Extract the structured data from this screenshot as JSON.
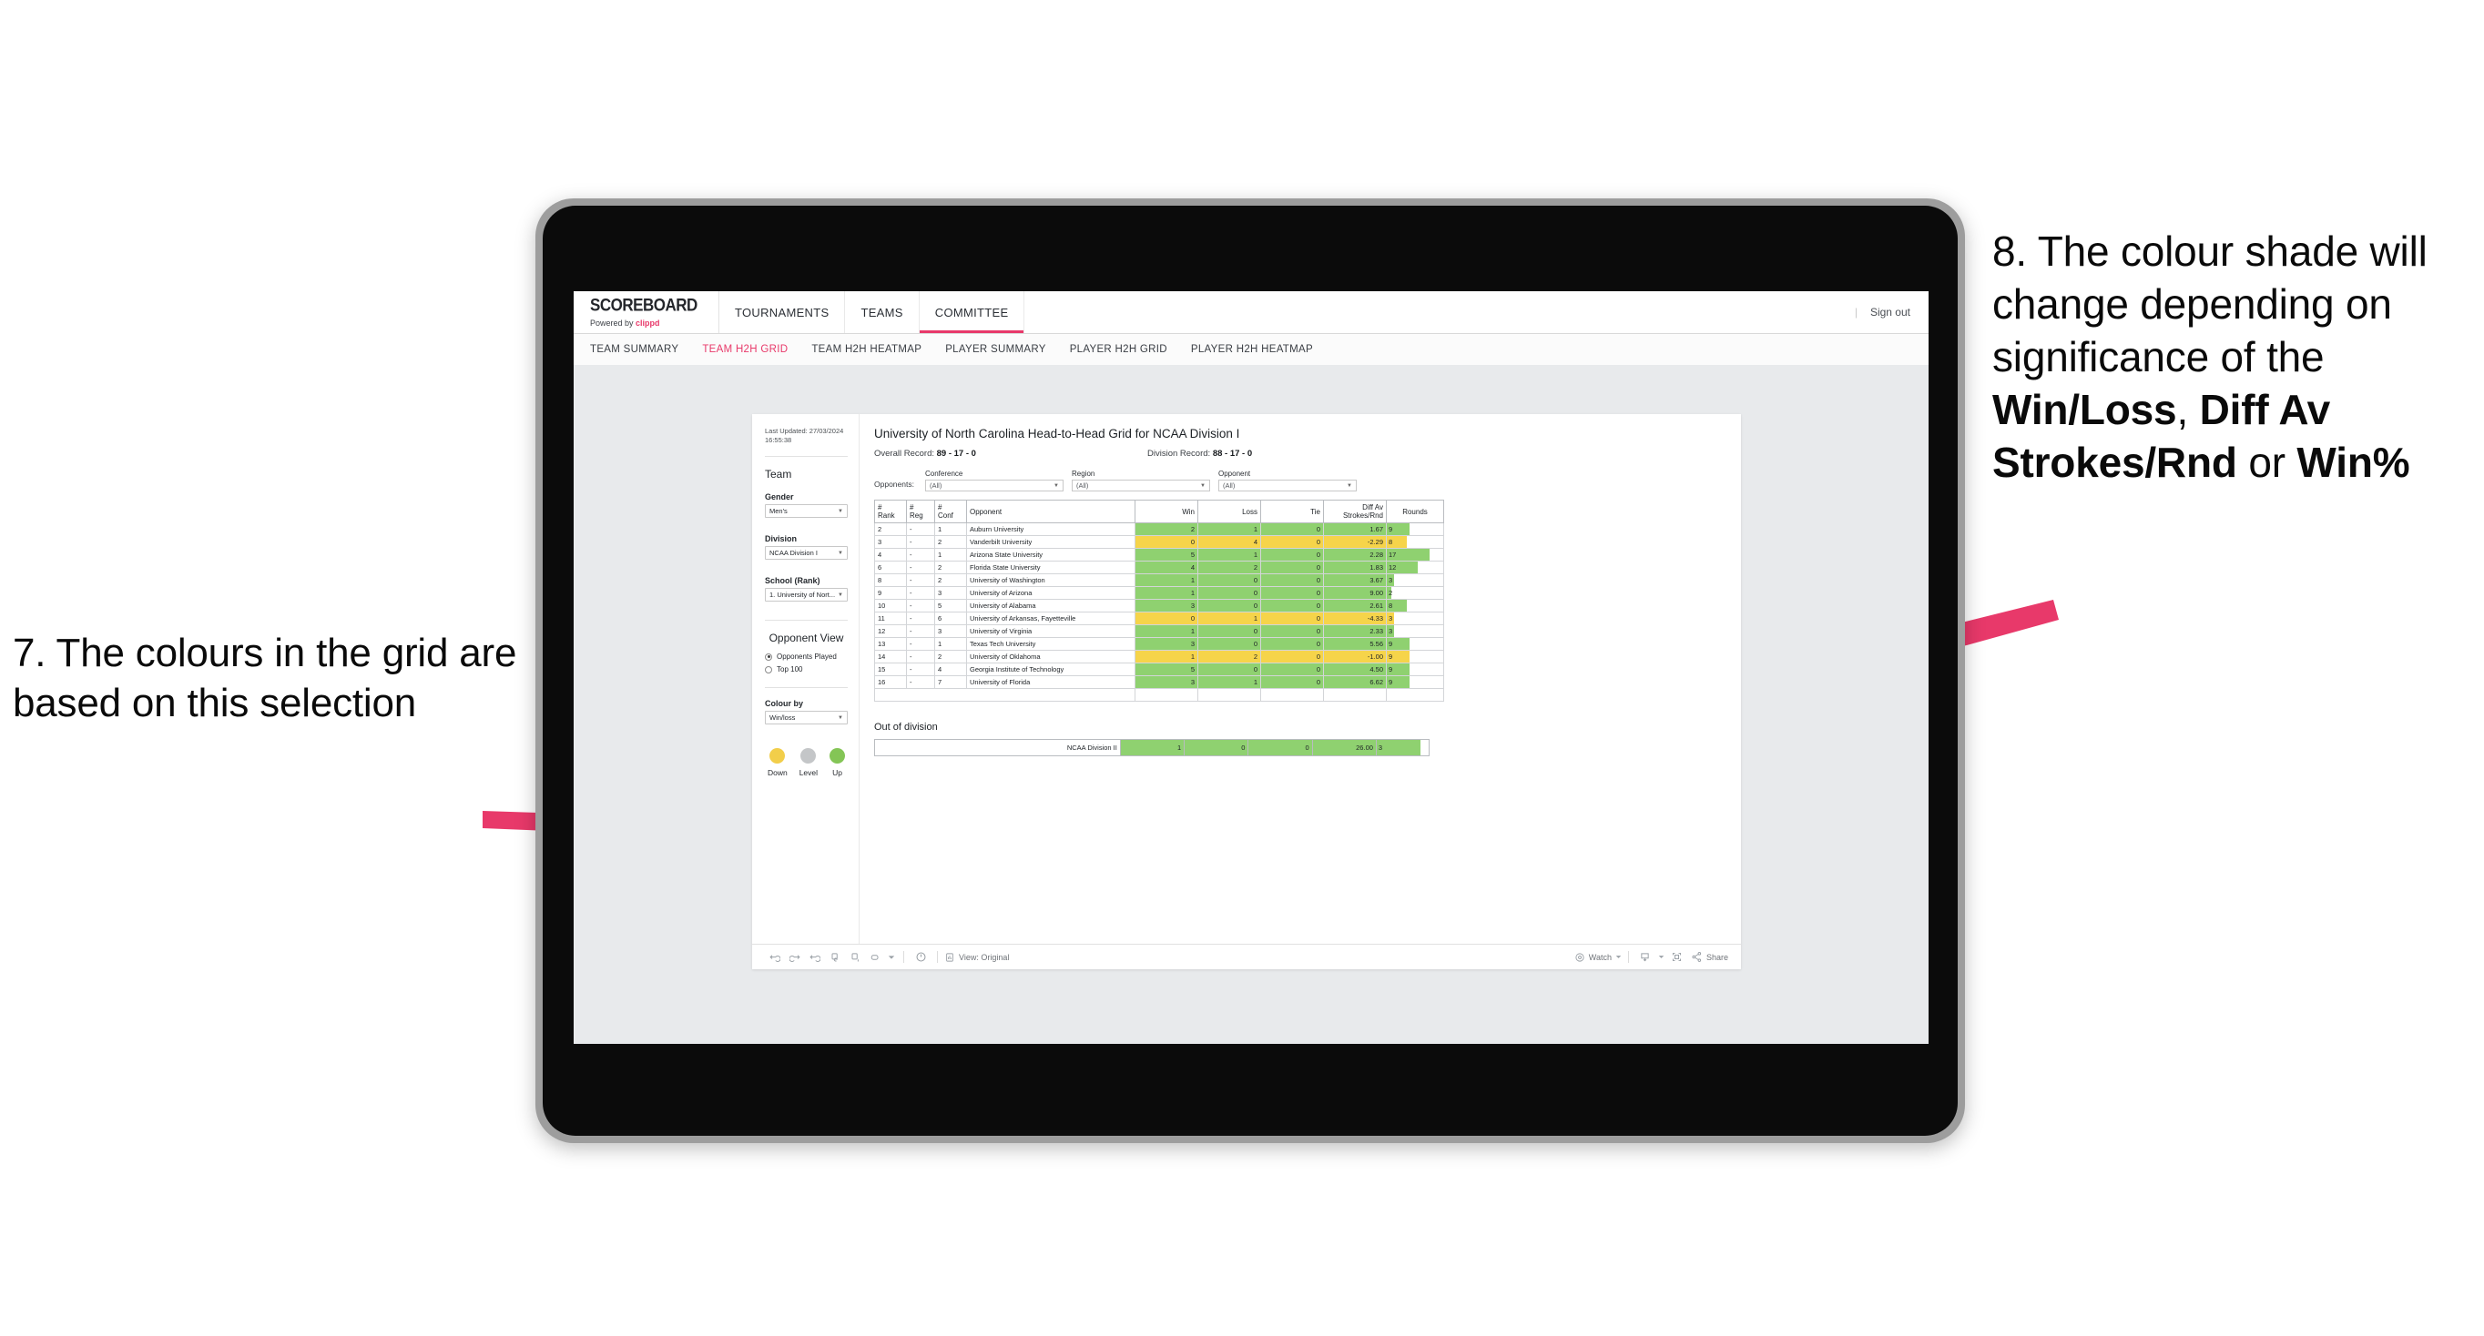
{
  "annotations": {
    "left": {
      "text": "7. The colours in the grid are based on this selection"
    },
    "right": {
      "line1": "8. The colour shade will change depending on significance of the ",
      "bold1": "Win/Loss",
      "mid1": ", ",
      "bold2": "Diff Av Strokes/Rnd",
      "mid2": " or ",
      "bold3": "Win%"
    },
    "arrow_color": "#e8396a"
  },
  "app": {
    "brand": {
      "title": "SCOREBOARD",
      "powered_by": "Powered by ",
      "clippd": "clippd"
    },
    "topnav": [
      {
        "label": "TOURNAMENTS",
        "active": false
      },
      {
        "label": "TEAMS",
        "active": false
      },
      {
        "label": "COMMITTEE",
        "active": true
      }
    ],
    "signout_divider": "|",
    "signout": "Sign out",
    "subnav": [
      {
        "label": "TEAM SUMMARY",
        "active": false
      },
      {
        "label": "TEAM H2H GRID",
        "active": true
      },
      {
        "label": "TEAM H2H HEATMAP",
        "active": false
      },
      {
        "label": "PLAYER SUMMARY",
        "active": false
      },
      {
        "label": "PLAYER H2H GRID",
        "active": false
      },
      {
        "label": "PLAYER H2H HEATMAP",
        "active": false
      }
    ],
    "accent": "#e8396a"
  },
  "filters": {
    "last_updated": "Last Updated: 27/03/2024 16:55:38",
    "team_heading": "Team",
    "gender_label": "Gender",
    "gender_value": "Men's",
    "division_label": "Division",
    "division_value": "NCAA Division I",
    "school_label": "School (Rank)",
    "school_value": "1. University of Nort...",
    "opponent_view_heading": "Opponent View",
    "opponent_view_options": [
      {
        "label": "Opponents Played",
        "selected": true
      },
      {
        "label": "Top 100",
        "selected": false
      }
    ],
    "colour_by_label": "Colour by",
    "colour_by_value": "Win/loss",
    "legend": [
      {
        "label": "Down",
        "color": "#f2ce4a"
      },
      {
        "label": "Level",
        "color": "#c4c6c8"
      },
      {
        "label": "Up",
        "color": "#84c556"
      }
    ]
  },
  "viz": {
    "title": "University of North Carolina Head-to-Head Grid for NCAA Division I",
    "overall_record_label": "Overall Record: ",
    "overall_record_value": "89 - 17 - 0",
    "division_record_label": "Division Record: ",
    "division_record_value": "88 - 17 - 0",
    "opponents_label": "Opponents:",
    "opponent_filters": [
      {
        "caption": "Conference",
        "value": "(All)"
      },
      {
        "caption": "Region",
        "value": "(All)"
      },
      {
        "caption": "Opponent",
        "value": "(All)"
      }
    ],
    "columns": [
      {
        "l1": "#",
        "l2": "Rank"
      },
      {
        "l1": "#",
        "l2": "Reg"
      },
      {
        "l1": "#",
        "l2": "Conf"
      },
      {
        "l1": "",
        "l2": "Opponent"
      },
      {
        "l1": "",
        "l2": "Win"
      },
      {
        "l1": "",
        "l2": "Loss"
      },
      {
        "l1": "",
        "l2": "Tie"
      },
      {
        "l1": "Diff Av",
        "l2": "Strokes/Rnd"
      },
      {
        "l1": "",
        "l2": "Rounds"
      }
    ],
    "rows": [
      {
        "rank": "2",
        "reg": "-",
        "conf": "1",
        "opponent": "Auburn University",
        "win": "2",
        "loss": "1",
        "tie": "0",
        "diff": "1.67",
        "rounds": "9",
        "state": "up",
        "bar_pct": 40
      },
      {
        "rank": "3",
        "reg": "-",
        "conf": "2",
        "opponent": "Vanderbilt University",
        "win": "0",
        "loss": "4",
        "tie": "0",
        "diff": "-2.29",
        "rounds": "8",
        "state": "down",
        "bar_pct": 35
      },
      {
        "rank": "4",
        "reg": "-",
        "conf": "1",
        "opponent": "Arizona State University",
        "win": "5",
        "loss": "1",
        "tie": "0",
        "diff": "2.28",
        "rounds": "17",
        "state": "up",
        "bar_pct": 76
      },
      {
        "rank": "6",
        "reg": "-",
        "conf": "2",
        "opponent": "Florida State University",
        "win": "4",
        "loss": "2",
        "tie": "0",
        "diff": "1.83",
        "rounds": "12",
        "state": "up",
        "bar_pct": 55
      },
      {
        "rank": "8",
        "reg": "-",
        "conf": "2",
        "opponent": "University of Washington",
        "win": "1",
        "loss": "0",
        "tie": "0",
        "diff": "3.67",
        "rounds": "3",
        "state": "up",
        "bar_pct": 13
      },
      {
        "rank": "9",
        "reg": "-",
        "conf": "3",
        "opponent": "University of Arizona",
        "win": "1",
        "loss": "0",
        "tie": "0",
        "diff": "9.00",
        "rounds": "2",
        "state": "up",
        "bar_pct": 8
      },
      {
        "rank": "10",
        "reg": "-",
        "conf": "5",
        "opponent": "University of Alabama",
        "win": "3",
        "loss": "0",
        "tie": "0",
        "diff": "2.61",
        "rounds": "8",
        "state": "up",
        "bar_pct": 35
      },
      {
        "rank": "11",
        "reg": "-",
        "conf": "6",
        "opponent": "University of Arkansas, Fayetteville",
        "win": "0",
        "loss": "1",
        "tie": "0",
        "diff": "-4.33",
        "rounds": "3",
        "state": "down",
        "bar_pct": 13
      },
      {
        "rank": "12",
        "reg": "-",
        "conf": "3",
        "opponent": "University of Virginia",
        "win": "1",
        "loss": "0",
        "tie": "0",
        "diff": "2.33",
        "rounds": "3",
        "state": "up",
        "bar_pct": 13
      },
      {
        "rank": "13",
        "reg": "-",
        "conf": "1",
        "opponent": "Texas Tech University",
        "win": "3",
        "loss": "0",
        "tie": "0",
        "diff": "5.56",
        "rounds": "9",
        "state": "up",
        "bar_pct": 40
      },
      {
        "rank": "14",
        "reg": "-",
        "conf": "2",
        "opponent": "University of Oklahoma",
        "win": "1",
        "loss": "2",
        "tie": "0",
        "diff": "-1.00",
        "rounds": "9",
        "state": "down",
        "bar_pct": 40
      },
      {
        "rank": "15",
        "reg": "-",
        "conf": "4",
        "opponent": "Georgia Institute of Technology",
        "win": "5",
        "loss": "0",
        "tie": "0",
        "diff": "4.50",
        "rounds": "9",
        "state": "up",
        "bar_pct": 40
      },
      {
        "rank": "16",
        "reg": "-",
        "conf": "7",
        "opponent": "University of Florida",
        "win": "3",
        "loss": "1",
        "tie": "0",
        "diff": "6.62",
        "rounds": "9",
        "state": "up",
        "bar_pct": 40
      }
    ],
    "out_of_division_title": "Out of division",
    "out_of_division_row": {
      "label": "NCAA Division II",
      "win": "1",
      "loss": "0",
      "tie": "0",
      "diff": "26.00",
      "rounds": "3",
      "state": "up",
      "bar_pct": 84
    },
    "colors": {
      "up": "#8fd170",
      "down": "#f6d44a",
      "level": "#c4c6c8"
    }
  },
  "toolbar": {
    "undo": "undo-icon",
    "redo": "redo-icon",
    "revert": "revert-icon",
    "refresh": "refresh-icon",
    "pause": "pause-icon",
    "view_orig_icon": "dashboard-icon",
    "view_label": "View: Original",
    "watch_label": "Watch",
    "share_label": "Share"
  },
  "chart_data": {
    "type": "table",
    "title": "University of North Carolina Head-to-Head Grid for NCAA Division I",
    "columns": [
      "# Rank",
      "# Reg",
      "# Conf",
      "Opponent",
      "Win",
      "Loss",
      "Tie",
      "Diff Av Strokes/Rnd",
      "Rounds"
    ],
    "rows": [
      [
        "2",
        "-",
        "1",
        "Auburn University",
        2,
        1,
        0,
        1.67,
        9
      ],
      [
        "3",
        "-",
        "2",
        "Vanderbilt University",
        0,
        4,
        0,
        -2.29,
        8
      ],
      [
        "4",
        "-",
        "1",
        "Arizona State University",
        5,
        1,
        0,
        2.28,
        17
      ],
      [
        "6",
        "-",
        "2",
        "Florida State University",
        4,
        2,
        0,
        1.83,
        12
      ],
      [
        "8",
        "-",
        "2",
        "University of Washington",
        1,
        0,
        0,
        3.67,
        3
      ],
      [
        "9",
        "-",
        "3",
        "University of Arizona",
        1,
        0,
        0,
        9.0,
        2
      ],
      [
        "10",
        "-",
        "5",
        "University of Alabama",
        3,
        0,
        0,
        2.61,
        8
      ],
      [
        "11",
        "-",
        "6",
        "University of Arkansas, Fayetteville",
        0,
        1,
        0,
        -4.33,
        3
      ],
      [
        "12",
        "-",
        "3",
        "University of Virginia",
        1,
        0,
        0,
        2.33,
        3
      ],
      [
        "13",
        "-",
        "1",
        "Texas Tech University",
        3,
        0,
        0,
        5.56,
        9
      ],
      [
        "14",
        "-",
        "2",
        "University of Oklahoma",
        1,
        2,
        0,
        -1.0,
        9
      ],
      [
        "15",
        "-",
        "4",
        "Georgia Institute of Technology",
        5,
        0,
        0,
        4.5,
        9
      ],
      [
        "16",
        "-",
        "7",
        "University of Florida",
        3,
        1,
        0,
        6.62,
        9
      ]
    ],
    "out_of_division": [
      [
        "NCAA Division II",
        1,
        0,
        0,
        26.0,
        3
      ]
    ],
    "colour_encoding": {
      "up": "#8fd170",
      "down": "#f6d44a",
      "level": "#c4c6c8"
    },
    "colour_by": "Win/loss"
  }
}
